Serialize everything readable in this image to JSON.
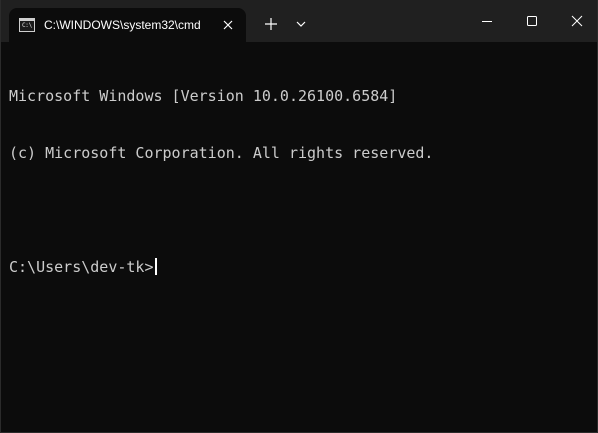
{
  "window": {
    "tab_title": "C:\\WINDOWS\\system32\\cmd",
    "tab_icon_text": "C:\\"
  },
  "terminal": {
    "lines": [
      "Microsoft Windows [Version 10.0.26100.6584]",
      "(c) Microsoft Corporation. All rights reserved.",
      "",
      "C:\\Users\\dev-tk>"
    ]
  },
  "icons": {
    "tab_icon": "command-prompt-icon",
    "tab_close": "close-icon",
    "new_tab": "plus-icon",
    "dropdown": "chevron-down-icon",
    "minimize": "minimize-icon",
    "maximize": "maximize-icon",
    "close": "close-icon"
  },
  "colors": {
    "background": "#0c0c0c",
    "titlebar": "#202020",
    "text": "#cccccc"
  }
}
